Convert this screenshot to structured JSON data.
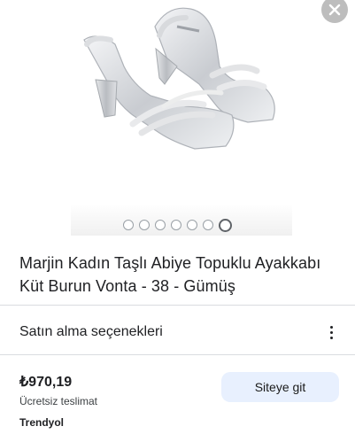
{
  "product": {
    "title": "Marjin Kadın Taşlı Abiye Topuklu Ayakkabı Küt Burun Vonta - 38 - Gümüş",
    "image": "silver-heeled-sandal",
    "gallery_count": 7,
    "gallery_active_index": 7
  },
  "purchase_section": {
    "label": "Satın alma seçenekleri"
  },
  "offer": {
    "price": "₺970,19",
    "shipping": "Ücretsiz teslimat",
    "seller": "Trendyol",
    "button_label": "Siteye git"
  },
  "icons": {
    "close": "close-icon",
    "more": "more-vert-icon"
  },
  "colors": {
    "button_bg": "#e8f0fe",
    "divider": "#dadce0",
    "close_bg": "#bdbdbd"
  }
}
